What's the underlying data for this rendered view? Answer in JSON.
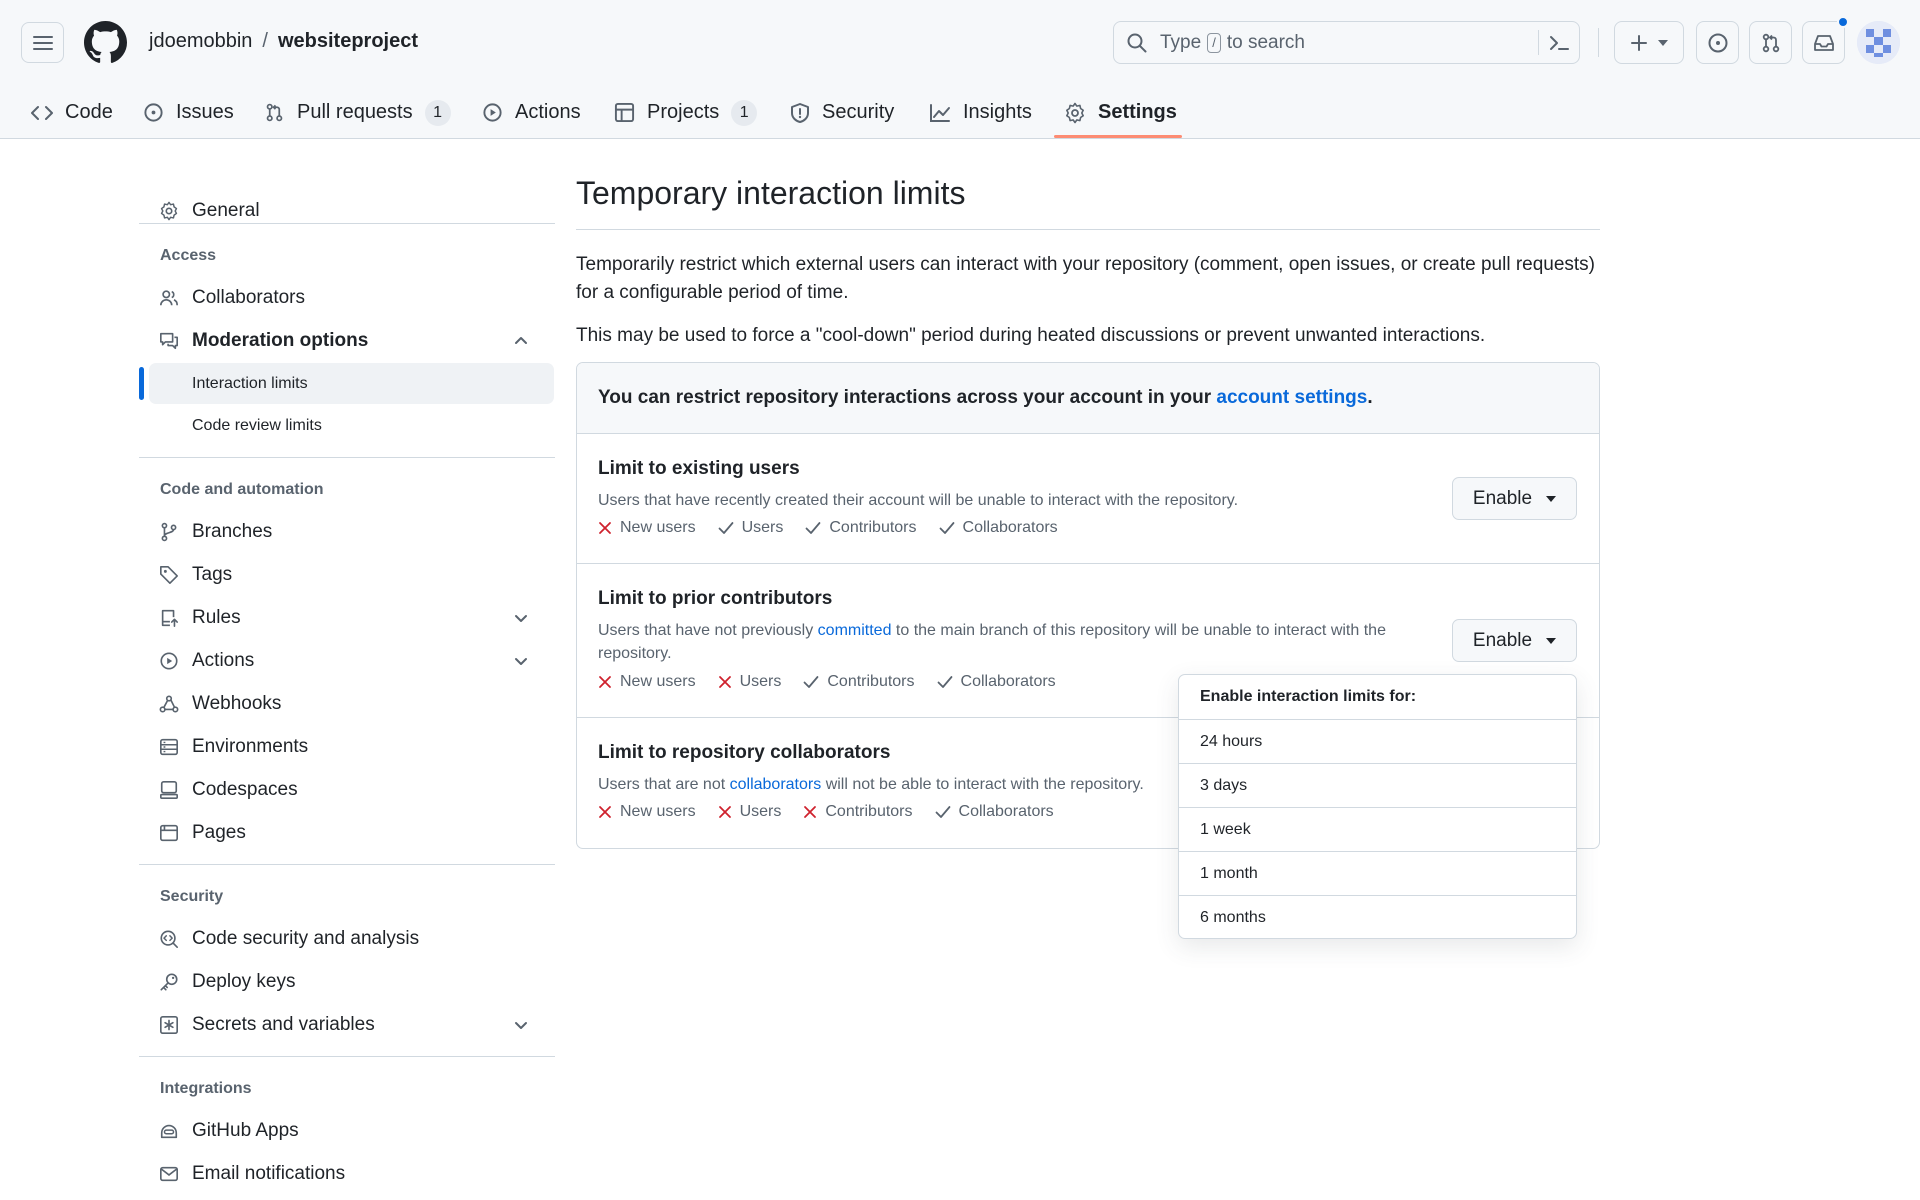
{
  "header": {
    "owner": "jdoemobbin",
    "separator": "/",
    "repo": "websiteproject",
    "search_prefix": "Type",
    "search_key": "/",
    "search_suffix": "to search"
  },
  "tabs": [
    {
      "label": "Code",
      "icon": "code-icon"
    },
    {
      "label": "Issues",
      "icon": "issue-opened-icon"
    },
    {
      "label": "Pull requests",
      "icon": "git-pull-request-icon",
      "count": "1"
    },
    {
      "label": "Actions",
      "icon": "play-icon"
    },
    {
      "label": "Projects",
      "icon": "table-icon",
      "count": "1"
    },
    {
      "label": "Security",
      "icon": "shield-icon"
    },
    {
      "label": "Insights",
      "icon": "graph-icon"
    },
    {
      "label": "Settings",
      "icon": "gear-icon",
      "active": true
    }
  ],
  "sidebar": {
    "general": "General",
    "sections": {
      "access": "Access",
      "code_automation": "Code and automation",
      "security": "Security",
      "integrations": "Integrations"
    },
    "items": {
      "collaborators": "Collaborators",
      "moderation": "Moderation options",
      "interaction_limits": "Interaction limits",
      "code_review_limits": "Code review limits",
      "branches": "Branches",
      "tags": "Tags",
      "rules": "Rules",
      "actions": "Actions",
      "webhooks": "Webhooks",
      "environments": "Environments",
      "codespaces": "Codespaces",
      "pages": "Pages",
      "code_security": "Code security and analysis",
      "deploy_keys": "Deploy keys",
      "secrets": "Secrets and variables",
      "github_apps": "GitHub Apps",
      "email_notifications": "Email notifications"
    }
  },
  "main": {
    "title": "Temporary interaction limits",
    "desc1": "Temporarily restrict which external users can interact with your repository (comment, open issues, or create pull requests) for a configurable period of time.",
    "desc2": "This may be used to force a \"cool-down\" period during heated discussions or prevent unwanted interactions.",
    "box_head_prefix": "You can restrict repository interactions across your account in your",
    "box_head_link": "account settings",
    "box_head_suffix": ".",
    "enable_label": "Enable",
    "rows": [
      {
        "title": "Limit to existing users",
        "desc_pre": "Users that have recently created their account will be unable to interact with the repository.",
        "desc_link": "",
        "desc_post": "",
        "perms": [
          {
            "label": "New users",
            "allowed": false
          },
          {
            "label": "Users",
            "allowed": true
          },
          {
            "label": "Contributors",
            "allowed": true
          },
          {
            "label": "Collaborators",
            "allowed": true
          }
        ]
      },
      {
        "title": "Limit to prior contributors",
        "desc_pre": "Users that have not previously",
        "desc_link": "committed",
        "desc_post": "to the main branch of this repository will be unable to interact with the repository.",
        "perms": [
          {
            "label": "New users",
            "allowed": false
          },
          {
            "label": "Users",
            "allowed": false
          },
          {
            "label": "Contributors",
            "allowed": true
          },
          {
            "label": "Collaborators",
            "allowed": true
          }
        ]
      },
      {
        "title": "Limit to repository collaborators",
        "desc_pre": "Users that are not",
        "desc_link": "collaborators",
        "desc_post": "will not be able to interact with the repository.",
        "perms": [
          {
            "label": "New users",
            "allowed": false
          },
          {
            "label": "Users",
            "allowed": false
          },
          {
            "label": "Contributors",
            "allowed": false
          },
          {
            "label": "Collaborators",
            "allowed": true
          }
        ]
      }
    ]
  },
  "dropdown": {
    "heading": "Enable interaction limits for:",
    "options": [
      "24 hours",
      "3 days",
      "1 week",
      "1 month",
      "6 months"
    ]
  },
  "colors": {
    "accent": "#0969da",
    "danger": "#cf222e",
    "tab_underline": "#fd8c73"
  }
}
